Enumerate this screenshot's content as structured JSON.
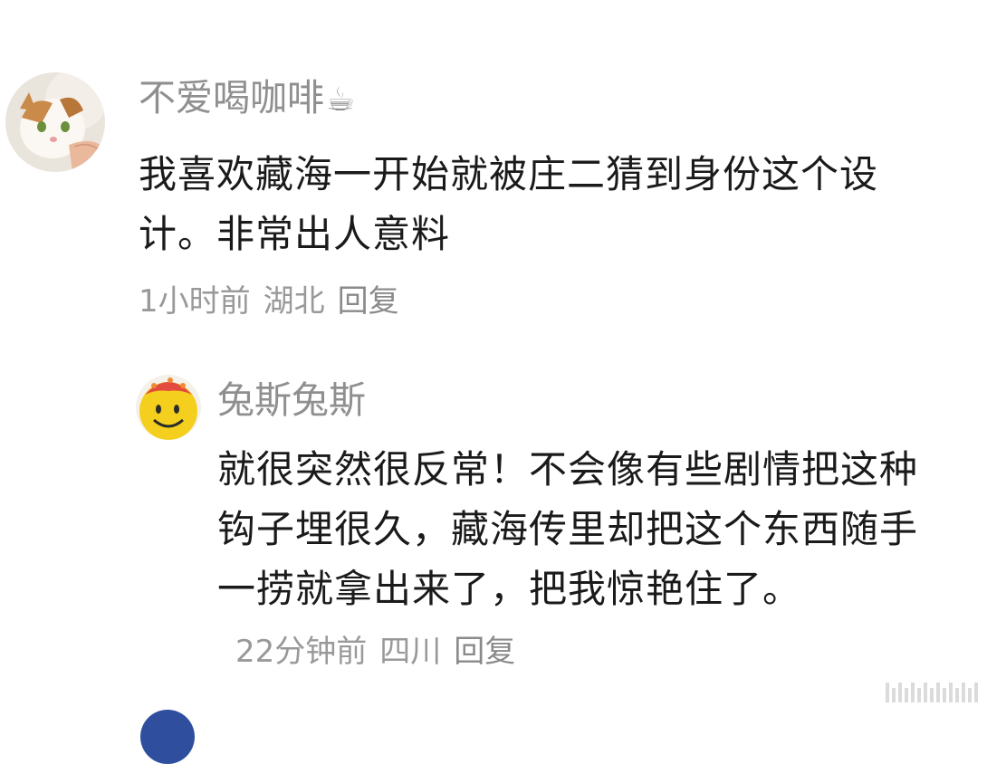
{
  "comments": [
    {
      "username": "不爱喝咖啡",
      "username_emoji": "☕",
      "avatar_icon": "cat-avatar-icon",
      "text": "我喜欢藏海一开始就被庄二猜到身份这个设计。非常出人意料",
      "time": "1小时前",
      "location": "湖北",
      "reply_label": "回复"
    }
  ],
  "replies": [
    {
      "username": "兔斯兔斯",
      "avatar_icon": "smiley-balloon-avatar-icon",
      "text": "就很突然很反常！不会像有些剧情把这种钩子埋很久，藏海传里却把这个东西随手一捞就拿出来了，把我惊艳住了。",
      "time": "22分钟前",
      "location": "四川",
      "reply_label": "回复"
    }
  ],
  "colors": {
    "username": "#8f8f8f",
    "body_text": "#1a1a1a",
    "meta": "#999999",
    "background": "#ffffff"
  }
}
